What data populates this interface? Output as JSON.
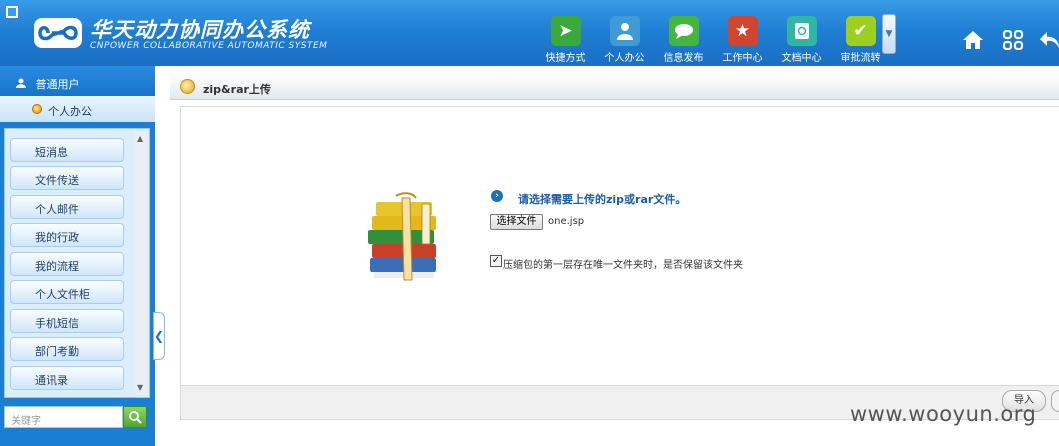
{
  "header": {
    "title": "华天动力协同办公系统",
    "subtitle": "CNPOWER COLLABORATIVE AUTOMATIC SYSTEM",
    "nav": [
      {
        "label": "快捷方式",
        "icon": "paper-plane-icon",
        "color": "#3aa83a"
      },
      {
        "label": "个人办公",
        "icon": "person-icon",
        "color": "#3f9ad6"
      },
      {
        "label": "信息发布",
        "icon": "speech-bubble-icon",
        "color": "#45b63d"
      },
      {
        "label": "工作中心",
        "icon": "star-icon",
        "color": "#d0452f"
      },
      {
        "label": "文档中心",
        "icon": "document-icon",
        "color": "#2fb7a3"
      },
      {
        "label": "审批流转",
        "icon": "checkmark-icon",
        "color": "#9ccf1f"
      }
    ]
  },
  "sidebar": {
    "user": "普通用户",
    "module": "个人办公",
    "items": [
      {
        "label": "短消息"
      },
      {
        "label": "文件传送"
      },
      {
        "label": "个人邮件"
      },
      {
        "label": "我的行政"
      },
      {
        "label": "我的流程"
      },
      {
        "label": "个人文件柜"
      },
      {
        "label": "手机短信"
      },
      {
        "label": "部门考勤"
      },
      {
        "label": "通讯录"
      }
    ],
    "search_placeholder": "关键字"
  },
  "main": {
    "title": "zip&rar上传",
    "prompt": "请选择需要上传的zip或rar文件。",
    "file_button": "选择文件",
    "file_name": "one.jsp",
    "checkbox_label": "压缩包的第一层存在唯一文件夹时，是否保留该文件夹",
    "checkbox_checked": true,
    "import_button": "导入"
  },
  "watermark": "www.wooyun.org"
}
